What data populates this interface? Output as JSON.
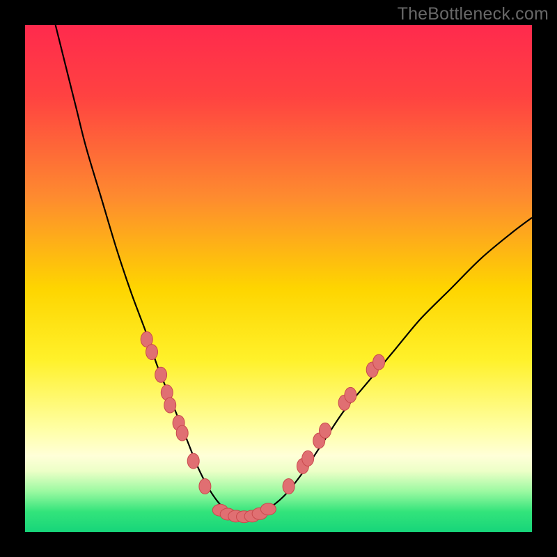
{
  "watermark": "TheBottleneck.com",
  "colors": {
    "frame": "#000000",
    "gradient_stops": [
      {
        "pct": 0,
        "color": "#ff2a4d"
      },
      {
        "pct": 14,
        "color": "#ff4241"
      },
      {
        "pct": 34,
        "color": "#fe8b2f"
      },
      {
        "pct": 52,
        "color": "#fed500"
      },
      {
        "pct": 66,
        "color": "#fff12a"
      },
      {
        "pct": 80,
        "color": "#ffffa8"
      },
      {
        "pct": 85,
        "color": "#ffffd8"
      },
      {
        "pct": 88,
        "color": "#ecffc7"
      },
      {
        "pct": 92,
        "color": "#9bf9a1"
      },
      {
        "pct": 96,
        "color": "#33e47b"
      },
      {
        "pct": 100,
        "color": "#17d57a"
      }
    ],
    "curve": "#000000",
    "dot_fill": "#e06f72",
    "dot_stroke": "#c9494c"
  },
  "chart_data": {
    "type": "line",
    "title": "",
    "xlabel": "",
    "ylabel": "",
    "xlim": [
      0,
      100
    ],
    "ylim": [
      0,
      100
    ],
    "series": [
      {
        "name": "bottleneck-curve",
        "x": [
          6,
          8,
          10,
          12,
          15,
          18,
          21,
          24,
          26,
          28,
          30,
          32,
          34,
          36,
          38,
          40,
          42,
          44,
          47,
          51,
          55,
          59,
          63,
          68,
          73,
          78,
          84,
          90,
          96,
          100
        ],
        "y": [
          100,
          92,
          84,
          76,
          66,
          56,
          47,
          39,
          33,
          28,
          23,
          18,
          13,
          9,
          6,
          4,
          3,
          3,
          4,
          7,
          12,
          18,
          24,
          30,
          36,
          42,
          48,
          54,
          59,
          62
        ]
      }
    ],
    "dots_left": [
      {
        "x": 24.0,
        "y": 38.0
      },
      {
        "x": 25.0,
        "y": 35.5
      },
      {
        "x": 26.8,
        "y": 31.0
      },
      {
        "x": 28.0,
        "y": 27.5
      },
      {
        "x": 28.6,
        "y": 25.0
      },
      {
        "x": 30.3,
        "y": 21.5
      },
      {
        "x": 31.0,
        "y": 19.5
      },
      {
        "x": 33.2,
        "y": 14.0
      },
      {
        "x": 35.5,
        "y": 9.0
      }
    ],
    "dots_bottom": [
      {
        "x": 38.5,
        "y": 4.3
      },
      {
        "x": 40.0,
        "y": 3.5
      },
      {
        "x": 41.6,
        "y": 3.1
      },
      {
        "x": 43.2,
        "y": 3.0
      },
      {
        "x": 44.8,
        "y": 3.1
      },
      {
        "x": 46.3,
        "y": 3.6
      },
      {
        "x": 48.0,
        "y": 4.5
      }
    ],
    "dots_right": [
      {
        "x": 52.0,
        "y": 9.0
      },
      {
        "x": 54.8,
        "y": 13.0
      },
      {
        "x": 55.8,
        "y": 14.5
      },
      {
        "x": 58.0,
        "y": 18.0
      },
      {
        "x": 59.2,
        "y": 20.0
      },
      {
        "x": 63.0,
        "y": 25.5
      },
      {
        "x": 64.2,
        "y": 27.0
      },
      {
        "x": 68.5,
        "y": 32.0
      },
      {
        "x": 69.8,
        "y": 33.5
      }
    ]
  }
}
